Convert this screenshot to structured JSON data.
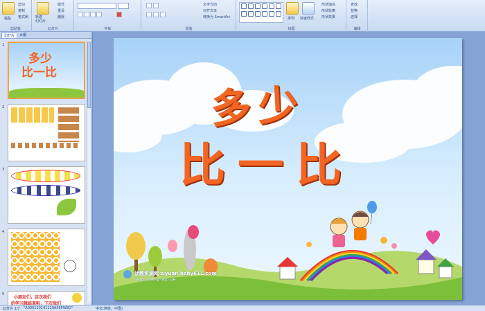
{
  "ribbon": {
    "clipboard": {
      "label": "剪贴板",
      "paste": "粘贴",
      "cut": "剪切",
      "copy": "复制",
      "format_painter": "格式刷"
    },
    "slides": {
      "label": "幻灯片",
      "new_slide": "新建\n幻灯片",
      "layout": "版式",
      "reset": "重设",
      "delete": "删除"
    },
    "font": {
      "label": "字体"
    },
    "paragraph": {
      "label": "段落",
      "text_direction": "文字方向",
      "align_text": "对齐文本",
      "smartart": "转换为 SmartArt"
    },
    "drawing": {
      "label": "绘图",
      "arrange": "排列",
      "quick_styles": "快速样式",
      "fill": "形状填充",
      "outline": "形状轮廓",
      "effects": "形状效果"
    },
    "editing": {
      "label": "编辑",
      "find": "查找",
      "replace": "替换",
      "select": "选择"
    }
  },
  "panel": {
    "tab_slides": "幻灯片",
    "tab_outline": "大纲"
  },
  "thumbs": [
    {
      "num": "1",
      "title_line1": "多少",
      "title_line2": "比一比"
    },
    {
      "num": "2"
    },
    {
      "num": "3"
    },
    {
      "num": "4"
    },
    {
      "num": "5",
      "text_line1": "小朋友们，这次我们",
      "text_line2": "的学习就结束啦，下次我们"
    }
  ],
  "slide": {
    "title_line1": "多少",
    "title_line2": "比一比",
    "watermark_site": "幼教资源网 ziyuan.baby611.com",
    "watermark_sub": "课件素材 · 免费下载 · 教案 · 试卷"
  },
  "status": {
    "slide_info": "幻灯片 1/7",
    "theme": "\"A000120141119A56PWBG\"",
    "language": "中文(简体，中国)"
  },
  "colors": {
    "title": "#f26522",
    "accent": "#f2a14a"
  }
}
